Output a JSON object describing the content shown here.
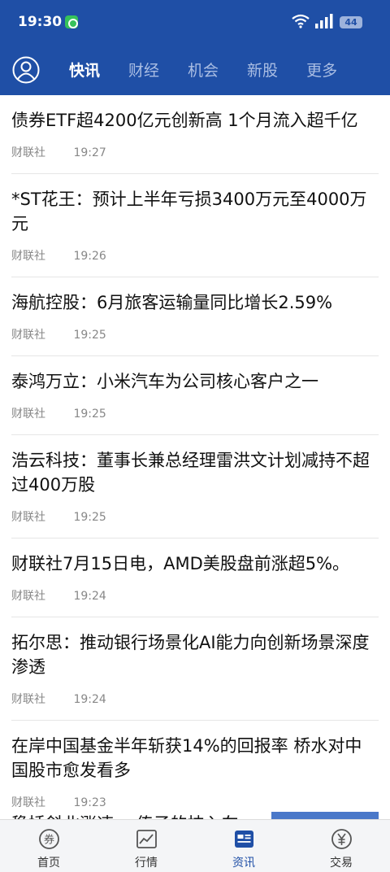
{
  "status": {
    "time": "19:30",
    "battery": "44"
  },
  "tabs": [
    {
      "label": "快讯",
      "active": true
    },
    {
      "label": "财经"
    },
    {
      "label": "机会"
    },
    {
      "label": "新股"
    },
    {
      "label": "更多"
    }
  ],
  "news": [
    {
      "title": "债券ETF超4200亿元创新高 1个月流入超千亿",
      "source": "财联社",
      "time": "19:27"
    },
    {
      "title": "*ST花王：预计上半年亏损3400万元至4000万元",
      "source": "财联社",
      "time": "19:26"
    },
    {
      "title": "海航控股：6月旅客运输量同比增长2.59%",
      "source": "财联社",
      "time": "19:25"
    },
    {
      "title": "泰鸿万立：小米汽车为公司核心客户之一",
      "source": "财联社",
      "time": "19:25"
    },
    {
      "title": "浩云科技：董事长兼总经理雷洪文计划减持不超过400万股",
      "source": "财联社",
      "time": "19:25"
    },
    {
      "title": "财联社7月15日电，AMD美股盘前涨超5%。",
      "source": "财联社",
      "time": "19:24"
    },
    {
      "title": "拓尔思：推动银行场景化AI能力向创新场景深度渗透",
      "source": "财联社",
      "time": "19:24"
    },
    {
      "title": "在岸中国基金半年斩获14%的回报率 桥水对中国股市愈发看多",
      "source": "财联社",
      "time": "19:23"
    }
  ],
  "partial_title": "稳插斜北涨速 一传子的技入车",
  "bottom_nav": [
    {
      "label": "首页",
      "icon": "coupon-icon"
    },
    {
      "label": "行情",
      "icon": "chart-icon"
    },
    {
      "label": "资讯",
      "icon": "news-icon",
      "active": true
    },
    {
      "label": "交易",
      "icon": "yuan-icon"
    }
  ],
  "colors": {
    "header": "#1f4fa6",
    "tab_inactive": "#a9bde3",
    "active_nav": "#1f4fa6"
  }
}
